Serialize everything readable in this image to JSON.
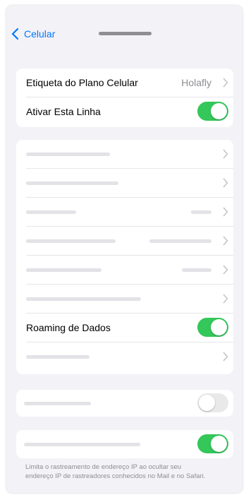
{
  "nav": {
    "back_label": "Celular"
  },
  "plan_section": {
    "plan_label": {
      "label": "Etiqueta do Plano Celular",
      "value": "Holafly"
    },
    "line_toggle": {
      "label": "Ativar Esta Linha",
      "on": true
    }
  },
  "data_section": {
    "roaming": {
      "label": "Roaming de Dados",
      "on": true
    }
  },
  "privacy_section": {
    "toggle_a": {
      "on": false
    },
    "toggle_b": {
      "on": true
    },
    "footer": "Limita o rastreamento de endereço IP ao ocultar seu endereço IP de rastreadores conhecidos no Mail e no Safari."
  },
  "colors": {
    "accent": "#007aff",
    "switch_on": "#34c759",
    "switch_off": "#e9e9ea"
  }
}
